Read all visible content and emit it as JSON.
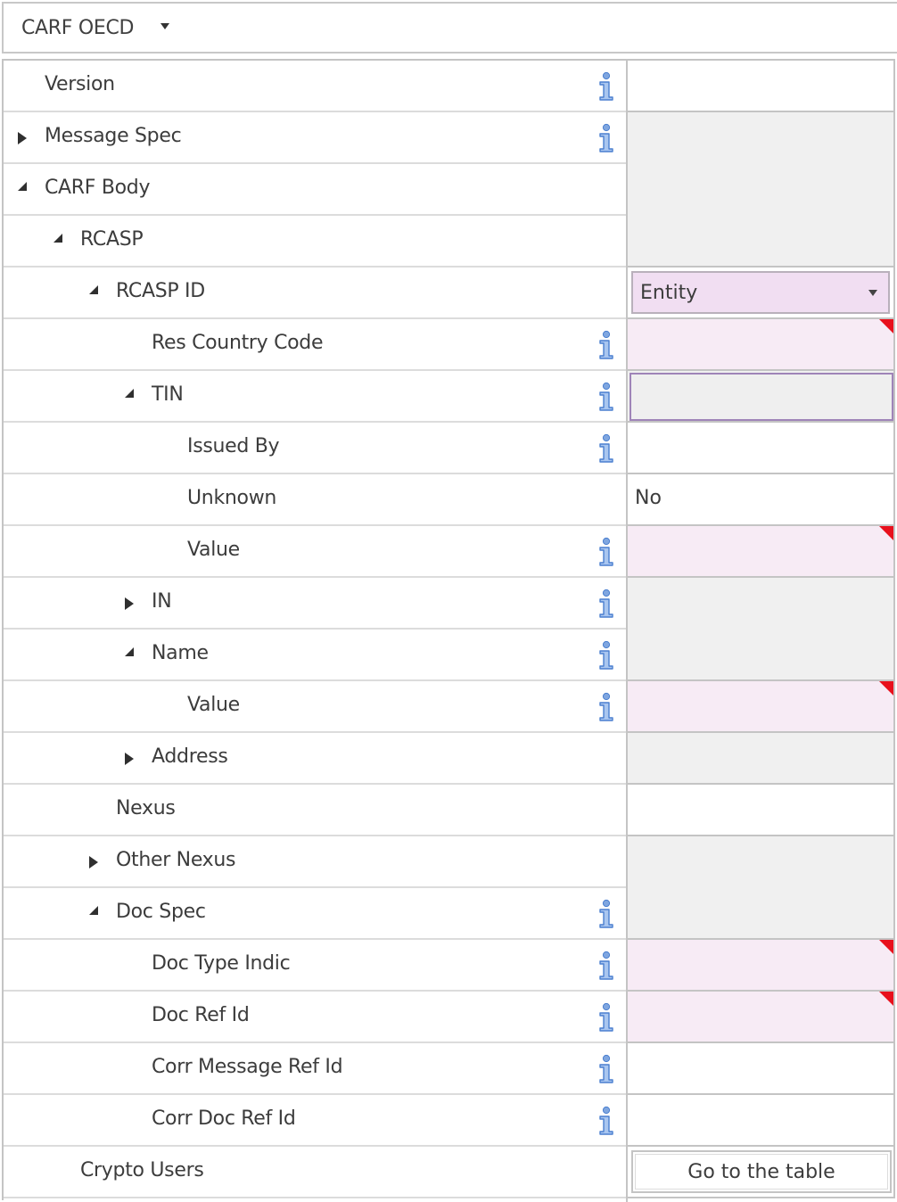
{
  "header": {
    "title": "CARF OECD",
    "dropdown_icon": "caret-down-icon"
  },
  "colors": {
    "required_flag": "#e8101c",
    "required_cell": "#f7ebf5",
    "group_cell": "#f0f0f0",
    "dropdown_bg": "#f1def2",
    "focus_border": "#9f84b8",
    "info_icon": "#5b8fd6"
  },
  "rows": [
    {
      "label": "Version",
      "level": 0,
      "toggle": "none",
      "info": true
    },
    {
      "label": "Message Spec",
      "level": 0,
      "toggle": "collapsed",
      "info": true
    },
    {
      "label": "CARF Body",
      "level": 0,
      "toggle": "expanded",
      "info": false
    },
    {
      "label": "RCASP",
      "level": 1,
      "toggle": "expanded",
      "info": false
    },
    {
      "label": "RCASP ID",
      "level": 2,
      "toggle": "expanded",
      "info": false
    },
    {
      "label": "Res Country Code",
      "level": 3,
      "toggle": "none",
      "info": true
    },
    {
      "label": "TIN",
      "level": 3,
      "toggle": "expanded",
      "info": true
    },
    {
      "label": "Issued By",
      "level": 4,
      "toggle": "none",
      "info": true
    },
    {
      "label": "Unknown",
      "level": 4,
      "toggle": "none",
      "info": false
    },
    {
      "label": "Value",
      "level": 4,
      "toggle": "none",
      "info": true
    },
    {
      "label": "IN",
      "level": 3,
      "toggle": "collapsed",
      "info": true
    },
    {
      "label": "Name",
      "level": 3,
      "toggle": "expanded",
      "info": true
    },
    {
      "label": "Value",
      "level": 4,
      "toggle": "none",
      "info": true
    },
    {
      "label": "Address",
      "level": 3,
      "toggle": "collapsed",
      "info": false
    },
    {
      "label": "Nexus",
      "level": 2,
      "toggle": "none",
      "info": false
    },
    {
      "label": "Other Nexus",
      "level": 2,
      "toggle": "collapsed",
      "info": false
    },
    {
      "label": "Doc Spec",
      "level": 2,
      "toggle": "expanded",
      "info": true
    },
    {
      "label": "Doc Type Indic",
      "level": 3,
      "toggle": "none",
      "info": true
    },
    {
      "label": "Doc Ref Id",
      "level": 3,
      "toggle": "none",
      "info": true
    },
    {
      "label": "Corr Message Ref Id",
      "level": 3,
      "toggle": "none",
      "info": true
    },
    {
      "label": "Corr Doc Ref Id",
      "level": 3,
      "toggle": "none",
      "info": true
    },
    {
      "label": "Crypto Users",
      "level": 1,
      "toggle": "none",
      "info": false
    }
  ],
  "values": {
    "version": "",
    "rcasp_id_type": "Entity",
    "res_country_code": "",
    "tin": "",
    "issued_by": "",
    "unknown": "No",
    "tin_value": "",
    "name_value": "",
    "nexus": "",
    "doc_type_indic": "",
    "doc_ref_id": "",
    "corr_message_ref_id": "",
    "corr_doc_ref_id": "",
    "crypto_users_button": "Go to the table"
  }
}
